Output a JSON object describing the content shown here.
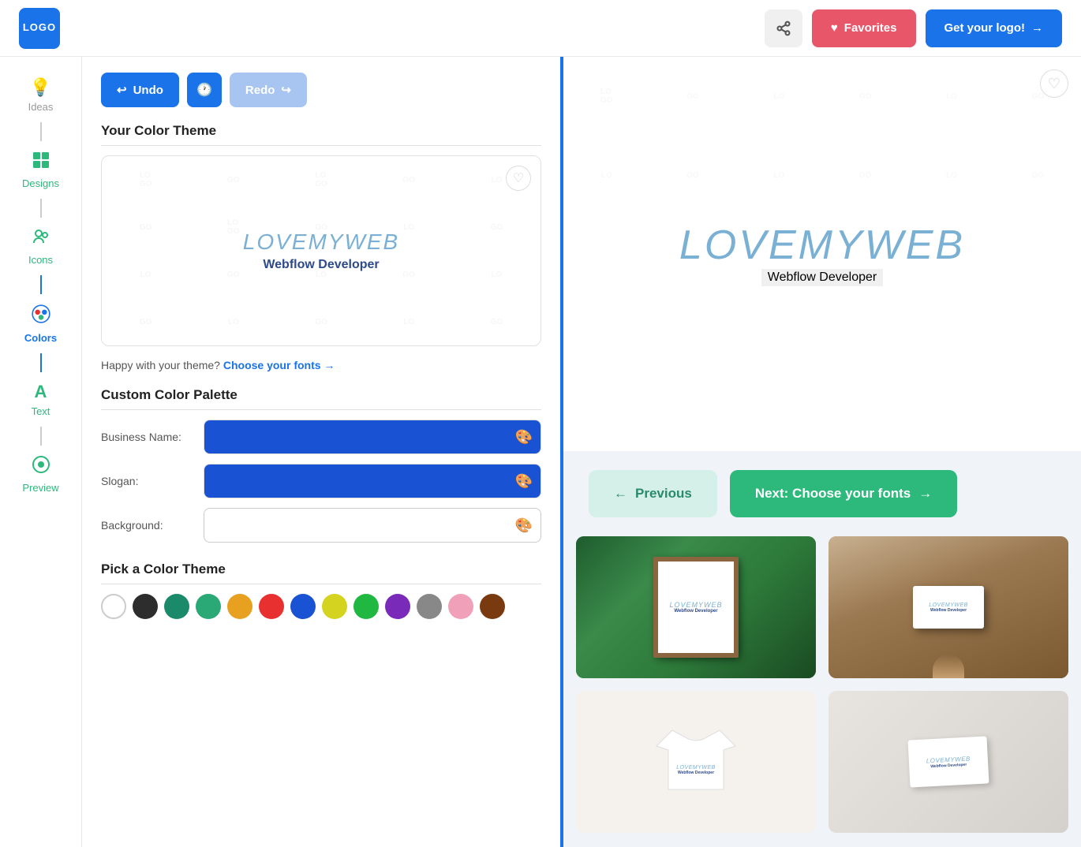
{
  "header": {
    "logo_text": "LOGO",
    "share_label": "🔗",
    "favorites_label": "Favorites",
    "get_logo_label": "Get your logo!",
    "arrow_right": "→"
  },
  "sidebar": {
    "items": [
      {
        "label": "Ideas",
        "icon": "💡",
        "active": false
      },
      {
        "label": "Designs",
        "icon": "🟩",
        "active": false
      },
      {
        "label": "Icons",
        "icon": "👤",
        "active": false
      },
      {
        "label": "Colors",
        "icon": "🎨",
        "active": true
      },
      {
        "label": "Text",
        "icon": "A",
        "active": false
      },
      {
        "label": "Preview",
        "icon": "👁",
        "active": false
      }
    ]
  },
  "toolbar": {
    "undo_label": "Undo",
    "history_icon": "🕐",
    "redo_label": "Redo"
  },
  "color_theme": {
    "title": "Your Color Theme",
    "logo_name": "LOVEMYWEB",
    "tagline": "Webflow Developer",
    "prompt": "Happy with your theme?",
    "choose_fonts_label": "Choose your fonts →"
  },
  "custom_palette": {
    "title": "Custom Color Palette",
    "business_name_label": "Business Name:",
    "slogan_label": "Slogan:",
    "background_label": "Background:",
    "business_color": "#1a52d4",
    "slogan_color": "#1a52d4",
    "background_color": "#ffffff"
  },
  "color_picker_section": {
    "title": "Pick a Color Theme",
    "swatches": [
      {
        "color": "#ffffff",
        "label": "white"
      },
      {
        "color": "#2d2d2d",
        "label": "dark"
      },
      {
        "color": "#1a8a6a",
        "label": "teal"
      },
      {
        "color": "#2aa876",
        "label": "green"
      },
      {
        "color": "#e8a020",
        "label": "orange"
      },
      {
        "color": "#e83030",
        "label": "red"
      },
      {
        "color": "#1a52d4",
        "label": "blue"
      },
      {
        "color": "#d4d420",
        "label": "yellow"
      },
      {
        "color": "#20b840",
        "label": "bright-green"
      },
      {
        "color": "#7a2ab8",
        "label": "purple"
      },
      {
        "color": "#888888",
        "label": "gray"
      },
      {
        "color": "#f0a0b8",
        "label": "pink"
      },
      {
        "color": "#7a3a10",
        "label": "brown"
      }
    ]
  },
  "preview": {
    "logo_name": "LOVEMYWEB",
    "tagline": "Webflow Developer",
    "prev_label": "Previous",
    "next_label": "Next: Choose your fonts",
    "arrow_left": "←",
    "arrow_right": "→"
  },
  "mockups": [
    {
      "type": "photo-frame",
      "style": "green-plants"
    },
    {
      "type": "business-card-hand",
      "style": "office"
    },
    {
      "type": "t-shirt",
      "style": "white"
    },
    {
      "type": "business-card-flat",
      "style": "light"
    }
  ],
  "watermark_text": "GO"
}
